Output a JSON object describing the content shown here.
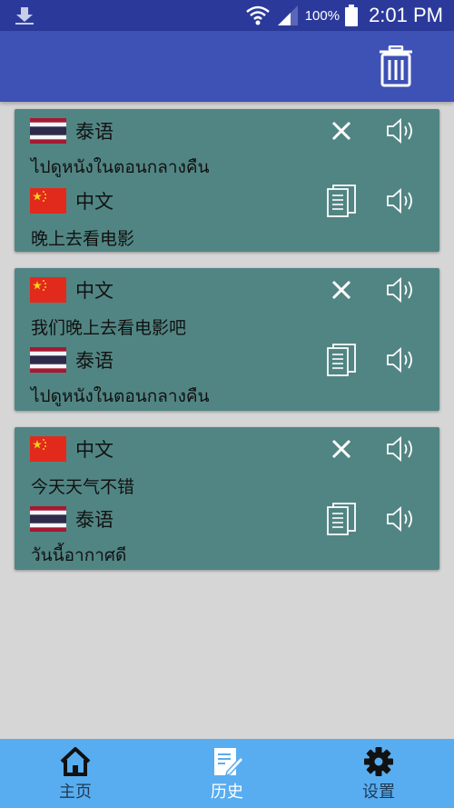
{
  "status_bar": {
    "battery": "100%",
    "time": "2:01 PM"
  },
  "cards": [
    {
      "source": {
        "flag": "thailand",
        "lang": "泰语",
        "text": "ไปดูหนังในตอนกลางคืน"
      },
      "target": {
        "flag": "china",
        "lang": "中文",
        "text": "晚上去看电影"
      }
    },
    {
      "source": {
        "flag": "china",
        "lang": "中文",
        "text": "我们晚上去看电影吧"
      },
      "target": {
        "flag": "thailand",
        "lang": "泰语",
        "text": "ไปดูหนังในตอนกลางคืน"
      }
    },
    {
      "source": {
        "flag": "china",
        "lang": "中文",
        "text": "今天天气不错"
      },
      "target": {
        "flag": "thailand",
        "lang": "泰语",
        "text": "วันนี้อากาศดี"
      }
    }
  ],
  "nav": {
    "home_label": "主页",
    "history_label": "历史",
    "settings_label": "设置",
    "active": "history"
  },
  "colors": {
    "status_bar": "#2b3a9a",
    "app_bar": "#3e51b5",
    "card": "#518583",
    "bottom_nav": "#58adf0",
    "background": "#d6d6d6"
  },
  "icons": {
    "app_bar": "trash-icon",
    "close": "close-icon",
    "copy": "copy-icon",
    "sound": "speaker-icon",
    "home": "home-icon",
    "history": "edit-icon",
    "settings": "gear-icon"
  }
}
